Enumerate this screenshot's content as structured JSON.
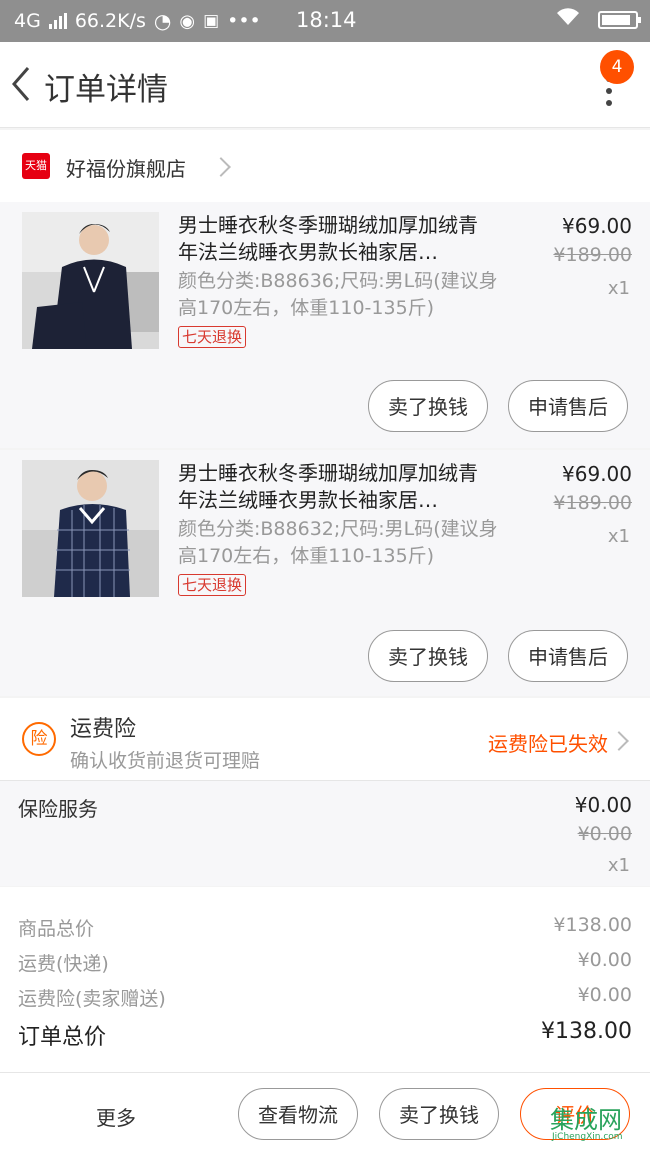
{
  "statusbar": {
    "network": "4G",
    "speed": "66.2K/s",
    "time": "18:14"
  },
  "nav": {
    "title": "订单详情",
    "badge": "4"
  },
  "shop": {
    "logo": "天猫",
    "name": "好福份旗舰店"
  },
  "items": [
    {
      "name": "男士睡衣秋冬季珊瑚绒加厚加绒青年法兰绒睡衣男款长袖家居…",
      "sku": "颜色分类:B88636;尺码:男L码(建议身高170左右，体重110-135斤)",
      "tag": "七天退换",
      "price": "¥69.00",
      "original_price": "¥189.00",
      "qty": "x1",
      "btn_sell": "卖了换钱",
      "btn_after": "申请售后"
    },
    {
      "name": "男士睡衣秋冬季珊瑚绒加厚加绒青年法兰绒睡衣男款长袖家居…",
      "sku": "颜色分类:B88632;尺码:男L码(建议身高170左右，体重110-135斤)",
      "tag": "七天退换",
      "price": "¥69.00",
      "original_price": "¥189.00",
      "qty": "x1",
      "btn_sell": "卖了换钱",
      "btn_after": "申请售后"
    }
  ],
  "insurance": {
    "icon": "险",
    "title": "运费险",
    "desc": "确认收货前退货可理赔",
    "status": "运费险已失效"
  },
  "service": {
    "label": "保险服务",
    "price": "¥0.00",
    "original_price": "¥0.00",
    "qty": "x1"
  },
  "summary": {
    "goods_label": "商品总价",
    "goods_value": "¥138.00",
    "shipping_label": "运费(快递)",
    "shipping_value": "¥0.00",
    "insurance_label": "运费险(卖家赠送)",
    "insurance_value": "¥0.00",
    "total_label": "订单总价",
    "total_value": "¥138.00"
  },
  "bottom": {
    "more": "更多",
    "logistics": "查看物流",
    "sell": "卖了换钱",
    "review": "评价"
  },
  "watermark": {
    "text": "集成网",
    "domain": "JiChengXin.com"
  },
  "colors": {
    "accent": "#ff5000",
    "tmall_red": "#e60012"
  }
}
